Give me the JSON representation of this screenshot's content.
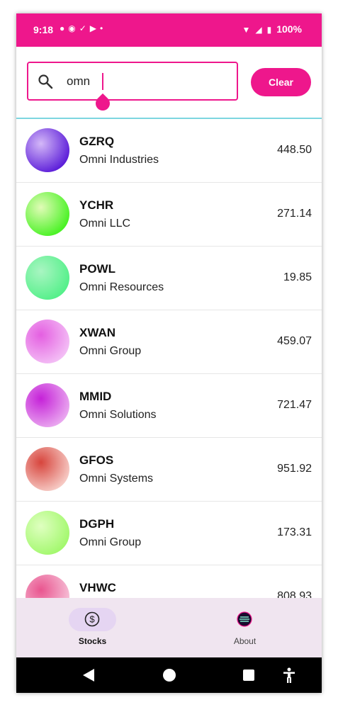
{
  "status_bar": {
    "time": "9:18",
    "battery": "100%",
    "icons": [
      "chat-icon",
      "face-icon",
      "check-circle-icon",
      "youtube-icon",
      "dot-icon",
      "wifi-icon",
      "signal-icon",
      "battery-icon"
    ]
  },
  "search": {
    "value": "omn",
    "clear_label": "Clear"
  },
  "colors": {
    "accent": "#ee178c",
    "nav_bg": "#f0e5f0",
    "nav_pill": "#e5d5f2"
  },
  "stocks": [
    {
      "ticker": "GZRQ",
      "name": "Omni Industries",
      "price": "448.50",
      "colors": [
        "#d4b8f8",
        "#5d1fd9"
      ]
    },
    {
      "ticker": "YCHR",
      "name": "Omni LLC",
      "price": "271.14",
      "colors": [
        "#e1fbb7",
        "#4af225"
      ]
    },
    {
      "ticker": "POWL",
      "name": "Omni Resources",
      "price": "19.85",
      "colors": [
        "#a9f5c2",
        "#55f08a"
      ]
    },
    {
      "ticker": "XWAN",
      "name": "Omni Group",
      "price": "459.07",
      "colors": [
        "#e45fe1",
        "#f3bdf5"
      ]
    },
    {
      "ticker": "MMID",
      "name": "Omni Solutions",
      "price": "721.47",
      "colors": [
        "#c522d8",
        "#e9a6ef"
      ]
    },
    {
      "ticker": "GFOS",
      "name": "Omni Systems",
      "price": "951.92",
      "colors": [
        "#d7453d",
        "#f6c9c3"
      ]
    },
    {
      "ticker": "DGPH",
      "name": "Omni Group",
      "price": "173.31",
      "colors": [
        "#dfffc0",
        "#a3f86e"
      ]
    },
    {
      "ticker": "VHWC",
      "name": "",
      "price": "808.93",
      "colors": [
        "#e9558f",
        "#f6c0d7"
      ]
    }
  ],
  "bottom_nav": {
    "stocks_label": "Stocks",
    "about_label": "About"
  }
}
